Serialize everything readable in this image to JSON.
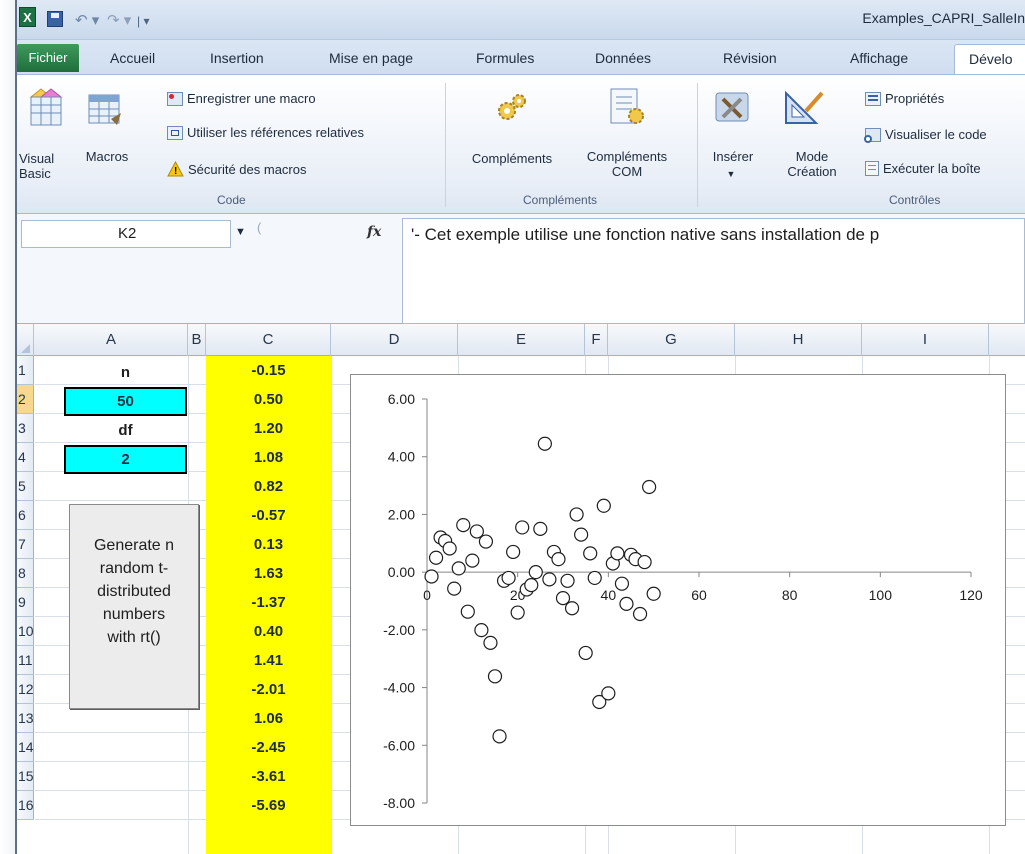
{
  "window": {
    "file_title": "Examples_CAPRI_SalleIn"
  },
  "tabs": [
    {
      "label": "Fichier"
    },
    {
      "label": "Accueil"
    },
    {
      "label": "Insertion"
    },
    {
      "label": "Mise en page"
    },
    {
      "label": "Formules"
    },
    {
      "label": "Données"
    },
    {
      "label": "Révision"
    },
    {
      "label": "Affichage"
    },
    {
      "label": "Dévelo"
    }
  ],
  "ribbon": {
    "code": {
      "label": "Code",
      "visual_basic": "Visual\nBasic",
      "macros": "Macros",
      "record_macro": "Enregistrer une macro",
      "relative_refs": "Utiliser les références relatives",
      "macro_security": "Sécurité des macros"
    },
    "addins": {
      "label": "Compléments",
      "addins": "Compléments",
      "com_addins": "Compléments\nCOM"
    },
    "controls": {
      "label": "Contrôles",
      "insert": "Insérer",
      "design_mode": "Mode\nCréation",
      "properties": "Propriétés",
      "view_code": "Visualiser le code",
      "run_dialog": "Exécuter la boîte"
    }
  },
  "formula_bar": {
    "name_box": "K2",
    "fx": "fx",
    "formula": "'- Cet exemple utilise une fonction native sans installation de p"
  },
  "sheet": {
    "columns": [
      "A",
      "B",
      "C",
      "D",
      "E",
      "F",
      "G",
      "H",
      "I"
    ],
    "rows": [
      "1",
      "2",
      "3",
      "4",
      "5",
      "6",
      "7",
      "8",
      "9",
      "10",
      "11",
      "12",
      "13",
      "14",
      "15",
      "16"
    ],
    "colA": {
      "r1": "n",
      "r2": "50",
      "r3": "df",
      "r4": "2"
    },
    "colC": [
      "-0.15",
      "0.50",
      "1.20",
      "1.08",
      "0.82",
      "-0.57",
      "0.13",
      "1.63",
      "-1.37",
      "0.40",
      "1.41",
      "-2.01",
      "1.06",
      "-2.45",
      "-3.61",
      "-5.69"
    ],
    "button_lines": [
      "Generate n",
      "random t-",
      "distributed",
      "numbers",
      "with rt()"
    ]
  },
  "chart_data": {
    "type": "scatter",
    "title": "",
    "xlim": [
      0,
      120
    ],
    "ylim": [
      -8,
      6
    ],
    "x_ticks": [
      "0",
      "20",
      "40",
      "60",
      "80",
      "100",
      "120"
    ],
    "y_ticks": [
      "6.00",
      "4.00",
      "2.00",
      "0.00",
      "-2.00",
      "-4.00",
      "-6.00",
      "-8.00"
    ],
    "x": [
      1,
      2,
      3,
      4,
      5,
      6,
      7,
      8,
      9,
      10,
      11,
      12,
      13,
      14,
      15,
      16,
      17,
      18,
      19,
      20,
      21,
      22,
      23,
      24,
      25,
      26,
      27,
      28,
      29,
      30,
      31,
      32,
      33,
      34,
      35,
      36,
      37,
      38,
      39,
      40,
      41,
      42,
      43,
      44,
      45,
      46,
      47,
      48,
      49,
      50
    ],
    "y": [
      -0.15,
      0.5,
      1.2,
      1.08,
      0.82,
      -0.57,
      0.13,
      1.63,
      -1.37,
      0.4,
      1.41,
      -2.01,
      1.06,
      -2.45,
      -3.61,
      -5.69,
      -0.3,
      -0.2,
      0.7,
      -1.4,
      1.55,
      -0.6,
      -0.45,
      0.0,
      1.5,
      4.45,
      -0.25,
      0.7,
      0.45,
      -0.9,
      -0.3,
      -1.25,
      2.0,
      1.3,
      -2.8,
      0.65,
      -0.2,
      -4.5,
      2.3,
      -4.2,
      0.3,
      0.65,
      -0.4,
      -1.1,
      0.6,
      0.45,
      -1.45,
      0.35,
      2.95,
      -0.75
    ]
  }
}
